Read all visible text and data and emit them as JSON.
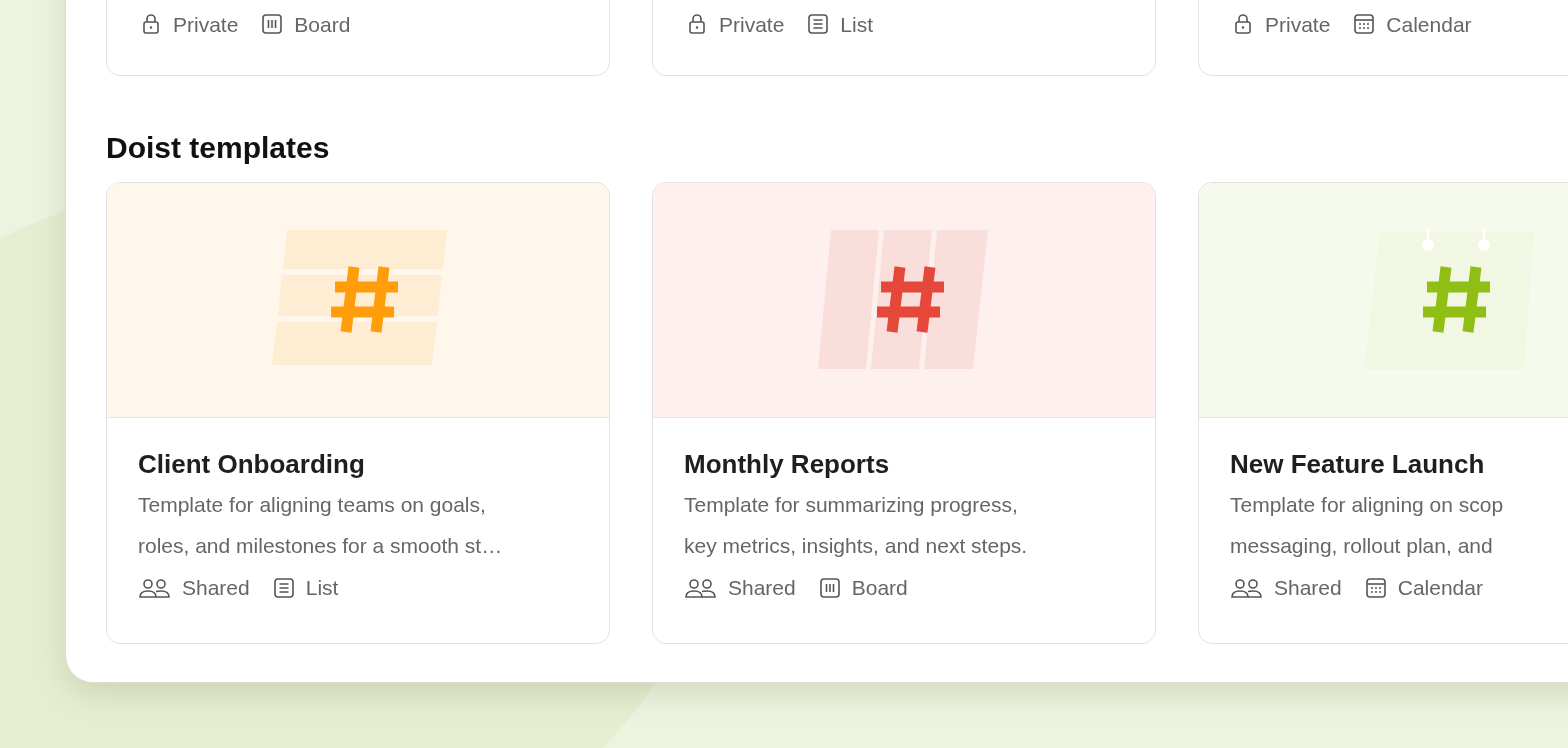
{
  "projects": [
    {
      "visibility": {
        "kind": "private",
        "label": "Private"
      },
      "view": {
        "kind": "board",
        "label": "Board"
      }
    },
    {
      "visibility": {
        "kind": "private",
        "label": "Private"
      },
      "view": {
        "kind": "list",
        "label": "List"
      }
    },
    {
      "visibility": {
        "kind": "private",
        "label": "Private"
      },
      "view": {
        "kind": "calendar",
        "label": "Calendar"
      }
    }
  ],
  "section_title": "Doist templates",
  "templates": [
    {
      "title": "Client Onboarding",
      "description": [
        "Template for aligning teams on goals,",
        "roles, and milestones for a smooth st…"
      ],
      "kind": "rows",
      "color": "#ff9d0a",
      "visibility": {
        "kind": "shared",
        "label": "Shared"
      },
      "view": {
        "kind": "list",
        "label": "List"
      }
    },
    {
      "title": "Monthly Reports",
      "description": [
        "Template for summarizing progress,",
        "key metrics, insights, and next steps."
      ],
      "kind": "columns",
      "color": "#e5483a",
      "visibility": {
        "kind": "shared",
        "label": "Shared"
      },
      "view": {
        "kind": "board",
        "label": "Board"
      }
    },
    {
      "title": "New Feature Launch",
      "description": [
        "Template for aligning on scop",
        "messaging, rollout plan, and"
      ],
      "kind": "calendar",
      "color": "#8fbf14",
      "visibility": {
        "kind": "shared",
        "label": "Shared"
      },
      "view": {
        "kind": "calendar",
        "label": "Calendar"
      }
    }
  ]
}
